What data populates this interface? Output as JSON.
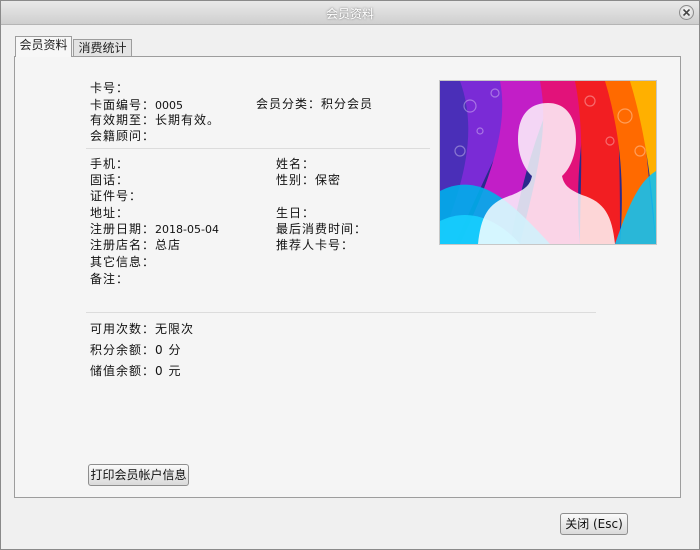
{
  "window": {
    "title": "会员资料"
  },
  "tabs": [
    {
      "label": "会员资料",
      "active": true
    },
    {
      "label": "消费统计",
      "active": false
    }
  ],
  "card": {
    "card_no": {
      "label": "卡号：",
      "value": ""
    },
    "face_no": {
      "label": "卡面编号：",
      "value": "0005"
    },
    "category": {
      "label": "会员分类：",
      "value": "积分会员"
    },
    "valid_until": {
      "label": "有效期至：",
      "value": "长期有效。"
    },
    "consultant": {
      "label": "会籍顾问：",
      "value": ""
    }
  },
  "member": {
    "mobile": {
      "label": "手机：",
      "value": ""
    },
    "name": {
      "label": "姓名：",
      "value": ""
    },
    "phone": {
      "label": "固话：",
      "value": ""
    },
    "gender": {
      "label": "性别：",
      "value": "保密"
    },
    "id_no": {
      "label": "证件号：",
      "value": ""
    },
    "address": {
      "label": "地址：",
      "value": ""
    },
    "birthday": {
      "label": "生日：",
      "value": ""
    },
    "reg_date": {
      "label": "注册日期：",
      "value": "2018-05-04"
    },
    "last_consume": {
      "label": "最后消费时间：",
      "value": ""
    },
    "reg_store": {
      "label": "注册店名：",
      "value": "总店"
    },
    "referrer": {
      "label": "推荐人卡号：",
      "value": ""
    },
    "other": {
      "label": "其它信息：",
      "value": ""
    },
    "remark": {
      "label": "备注：",
      "value": ""
    }
  },
  "balance": {
    "uses": {
      "label": "可用次数：",
      "value": "无限次"
    },
    "points": {
      "label": "积分余额：",
      "value": "0 分"
    },
    "stored": {
      "label": "储值余额：",
      "value": "0 元"
    }
  },
  "buttons": {
    "print": "打印会员帐户信息",
    "close": "关闭 (Esc)"
  },
  "icons": {
    "close": "close-icon",
    "avatar": "avatar-silhouette-icon"
  }
}
